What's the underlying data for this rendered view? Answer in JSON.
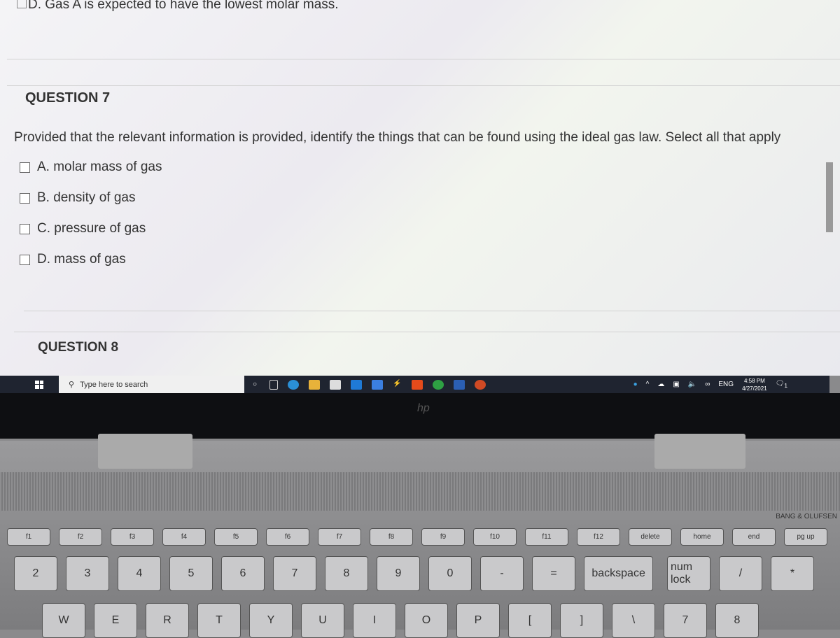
{
  "page": {
    "previous_option": "D. Gas A is expected to have the lowest molar mass.",
    "question7": {
      "title": "QUESTION 7",
      "text": "Provided that the relevant information is provided, identify the things that can be found using the ideal gas law. Select all that apply",
      "options": [
        "A. molar mass of gas",
        "B. density of gas",
        "C. pressure of gas",
        "D. mass of gas"
      ]
    },
    "question8": {
      "title": "QUESTION 8"
    }
  },
  "taskbar": {
    "search_placeholder": "Type here to search",
    "language": "ENG",
    "time": "4:58 PM",
    "date": "4/27/2021",
    "notification_count": "1"
  },
  "laptop": {
    "logo": "hp",
    "brand": "BANG & OLUFSEN"
  },
  "keyboard": {
    "fn_row": [
      "f1",
      "f2",
      "f3",
      "f4",
      "f5",
      "f6",
      "f7",
      "f8",
      "f9",
      "f10",
      "f11",
      "f12",
      "delete",
      "home",
      "end",
      "pg up"
    ],
    "num_row": [
      "2",
      "3",
      "4",
      "5",
      "6",
      "7",
      "8",
      "9",
      "0",
      "-",
      "=",
      "backspace",
      "num lock",
      "/",
      "*"
    ],
    "letter_row": [
      "W",
      "E",
      "R",
      "T",
      "Y",
      "U",
      "I",
      "O",
      "P",
      "[",
      "]",
      "\\",
      "7",
      "8"
    ]
  }
}
